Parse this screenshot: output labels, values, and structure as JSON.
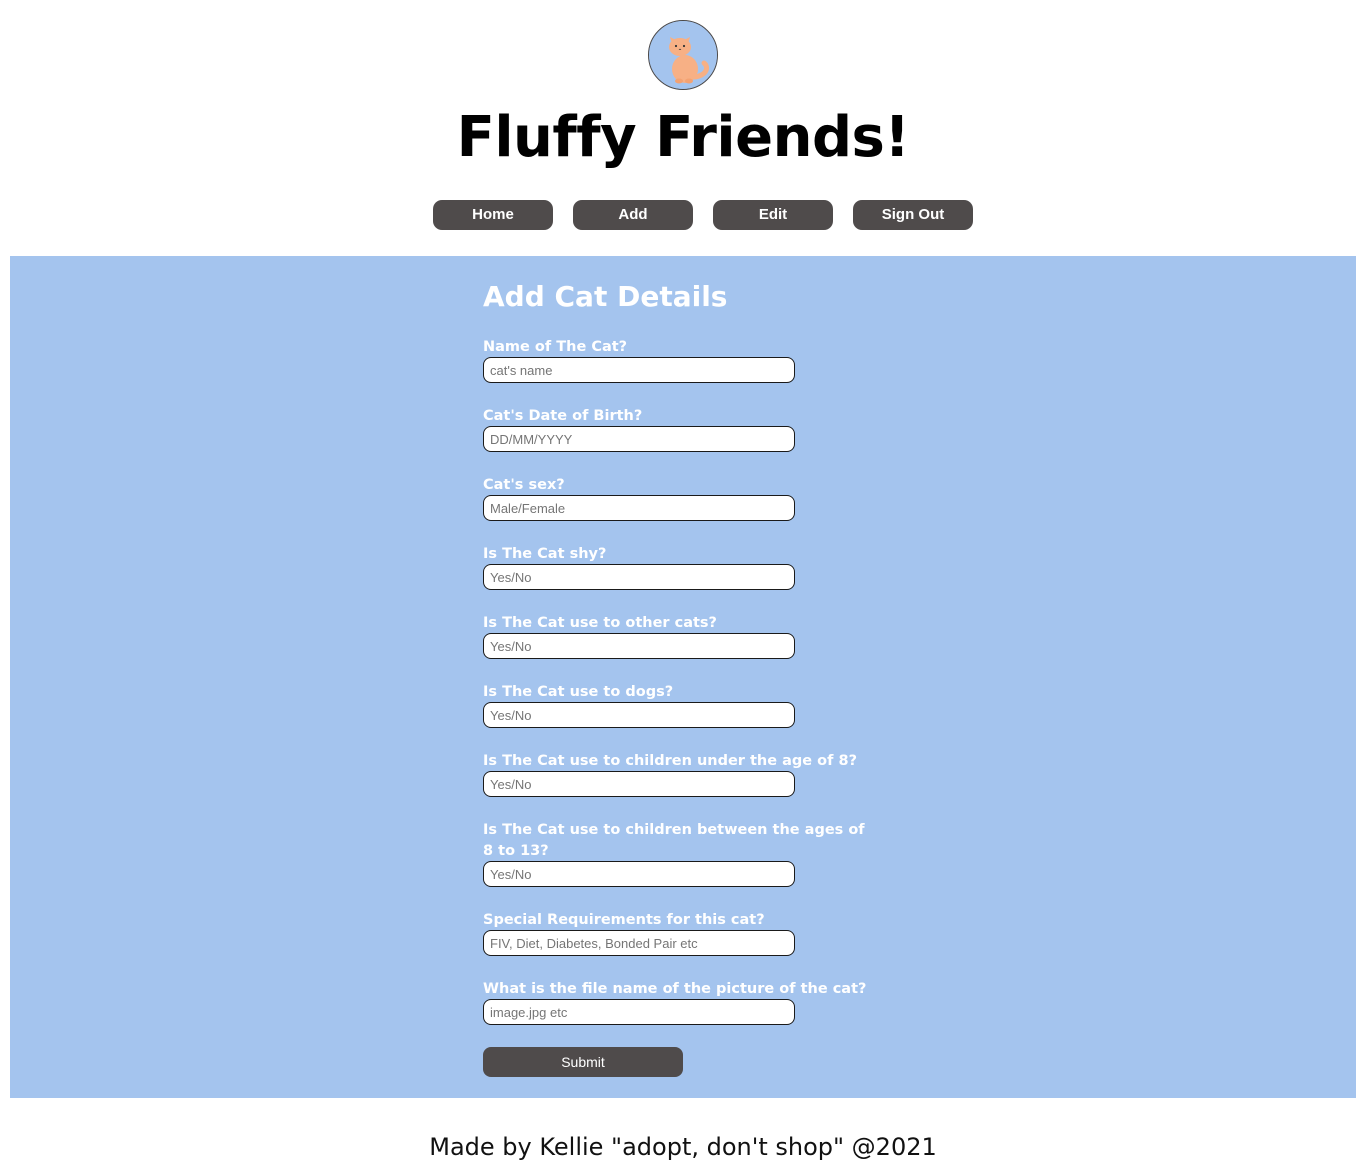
{
  "header": {
    "logo_alt": "cat logo",
    "title": "Fluffy Friends!"
  },
  "nav": {
    "items": [
      {
        "label": "Home"
      },
      {
        "label": "Add"
      },
      {
        "label": "Edit"
      },
      {
        "label": "Sign Out"
      }
    ]
  },
  "form": {
    "title": "Add Cat Details",
    "fields": [
      {
        "label": "Name of The Cat?",
        "placeholder": "cat's name",
        "value": ""
      },
      {
        "label": "Cat's Date of Birth?",
        "placeholder": "DD/MM/YYYY",
        "value": ""
      },
      {
        "label": "Cat's sex?",
        "placeholder": "Male/Female",
        "value": ""
      },
      {
        "label": "Is The Cat shy?",
        "placeholder": "Yes/No",
        "value": ""
      },
      {
        "label": "Is The Cat use to other cats?",
        "placeholder": "Yes/No",
        "value": ""
      },
      {
        "label": "Is The Cat use to dogs?",
        "placeholder": "Yes/No",
        "value": ""
      },
      {
        "label": "Is The Cat use to children under the age of 8?",
        "placeholder": "Yes/No",
        "value": ""
      },
      {
        "label": "Is The Cat use to children between the ages of 8 to 13?",
        "placeholder": "Yes/No",
        "value": ""
      },
      {
        "label": "Special Requirements for this cat?",
        "placeholder": "FIV, Diet, Diabetes, Bonded Pair etc",
        "value": ""
      },
      {
        "label": "What is the file name of the picture of the cat?",
        "placeholder": "image.jpg etc",
        "value": ""
      }
    ],
    "submit_label": "Submit"
  },
  "footer": {
    "text": "Made by Kellie \"adopt, don't shop\" @2021"
  },
  "colors": {
    "panel_bg": "#a4c4ee",
    "button_bg": "#4f4b4b",
    "cat_orange": "#f7b085"
  }
}
